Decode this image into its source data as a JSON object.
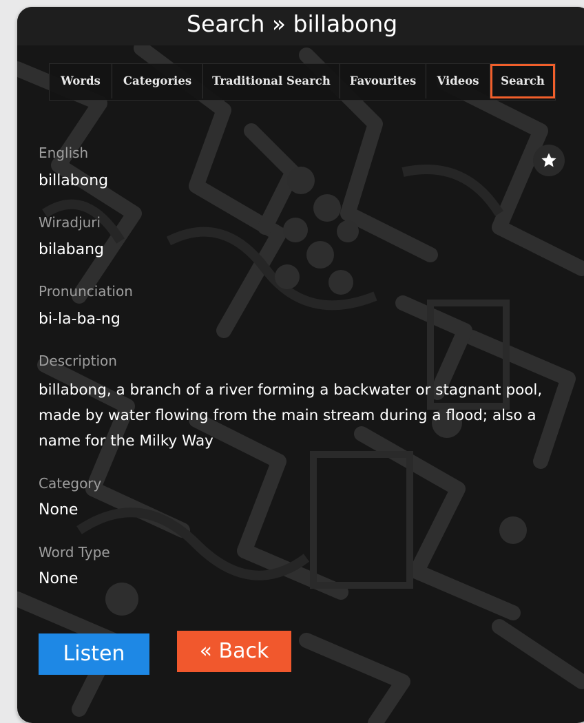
{
  "header": {
    "title": "Search » billabong"
  },
  "nav": {
    "tabs": [
      {
        "label": "Words"
      },
      {
        "label": "Categories"
      },
      {
        "label": "Traditional Search"
      },
      {
        "label": "Favourites"
      },
      {
        "label": "Videos"
      },
      {
        "label": "Search",
        "active": true
      }
    ]
  },
  "favourite": {
    "icon": "star-icon"
  },
  "entry": {
    "english_label": "English",
    "english_value": "billabong",
    "wiradjuri_label": "Wiradjuri",
    "wiradjuri_value": "bilabang",
    "pronunciation_label": "Pronunciation",
    "pronunciation_value": "bi-la-ba-ng",
    "description_label": "Description",
    "description_value": "billabong, a branch of a river forming a backwater or stagnant pool, made by water flowing from the main stream during a flood; also a name for the Milky Way",
    "category_label": "Category",
    "category_value": "None",
    "word_type_label": "Word Type",
    "word_type_value": "None"
  },
  "actions": {
    "listen_label": "Listen",
    "back_label": "« Back"
  },
  "colors": {
    "accent": "#f15f2b",
    "listen": "#1e88e5",
    "background": "#161616"
  }
}
